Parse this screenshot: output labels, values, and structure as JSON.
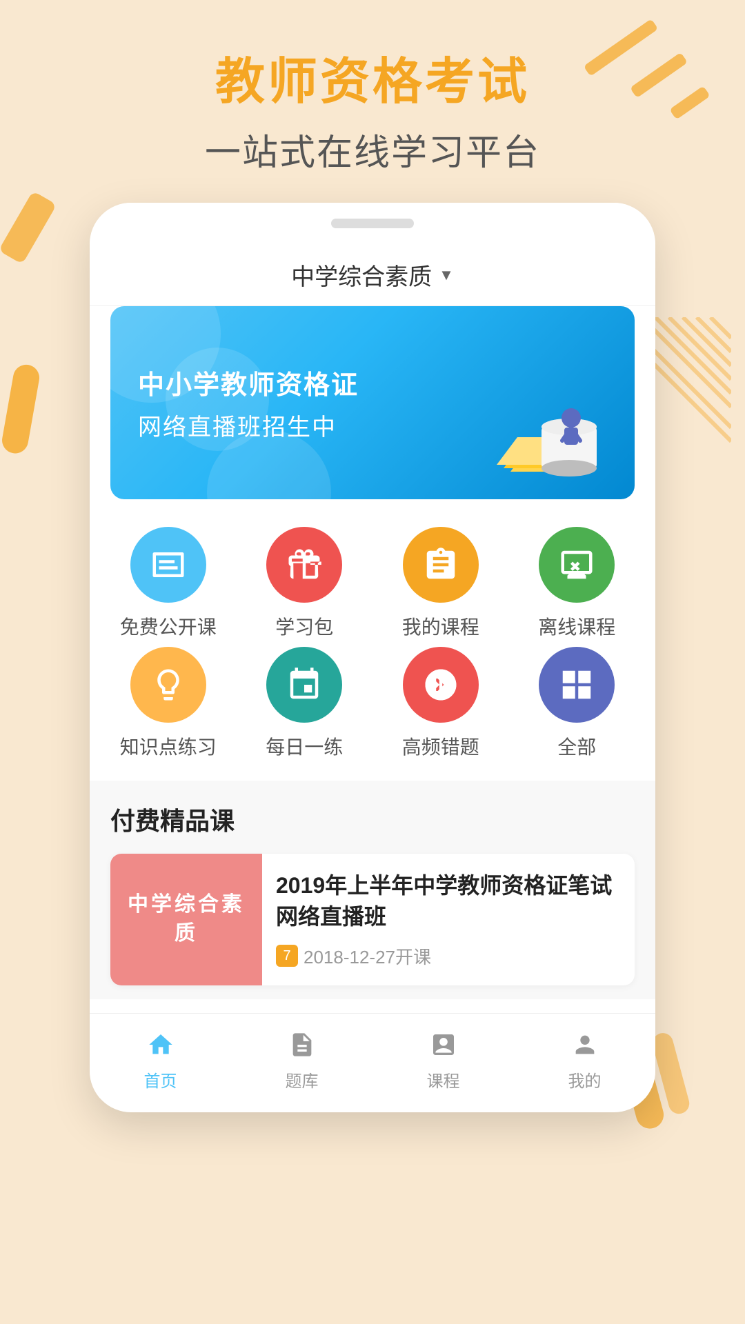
{
  "app": {
    "title": "教师资格考试",
    "subtitle": "一站式在线学习平台"
  },
  "navbar": {
    "selected_subject": "中学综合素质",
    "dropdown_icon": "▼"
  },
  "banner": {
    "line1": "中小学教师资格证",
    "line2": "网络直播班招生中"
  },
  "menu": {
    "row1": [
      {
        "label": "免费公开课",
        "icon_color": "icon-blue",
        "icon_type": "book"
      },
      {
        "label": "学习包",
        "icon_color": "icon-red",
        "icon_type": "gift"
      },
      {
        "label": "我的课程",
        "icon_color": "icon-orange",
        "icon_type": "clipboard"
      },
      {
        "label": "离线课程",
        "icon_color": "icon-green",
        "icon_type": "monitor-x"
      }
    ],
    "row2": [
      {
        "label": "知识点练习",
        "icon_color": "icon-yellow",
        "icon_type": "bulb"
      },
      {
        "label": "每日一练",
        "icon_color": "icon-green2",
        "icon_type": "calendar"
      },
      {
        "label": "高频错题",
        "icon_color": "icon-pink",
        "icon_type": "edit-circle"
      },
      {
        "label": "全部",
        "icon_color": "icon-blue2",
        "icon_type": "grid"
      }
    ]
  },
  "section": {
    "title": "付费精品课",
    "courses": [
      {
        "thumbnail_text": "中学综合素质",
        "title": "2019年上半年中学教师资格证笔试网络直播班",
        "date": "2018-12-27开课"
      }
    ]
  },
  "bottom_nav": {
    "items": [
      {
        "label": "首页",
        "active": true
      },
      {
        "label": "题库",
        "active": false
      },
      {
        "label": "课程",
        "active": false
      },
      {
        "label": "我的",
        "active": false
      }
    ]
  }
}
